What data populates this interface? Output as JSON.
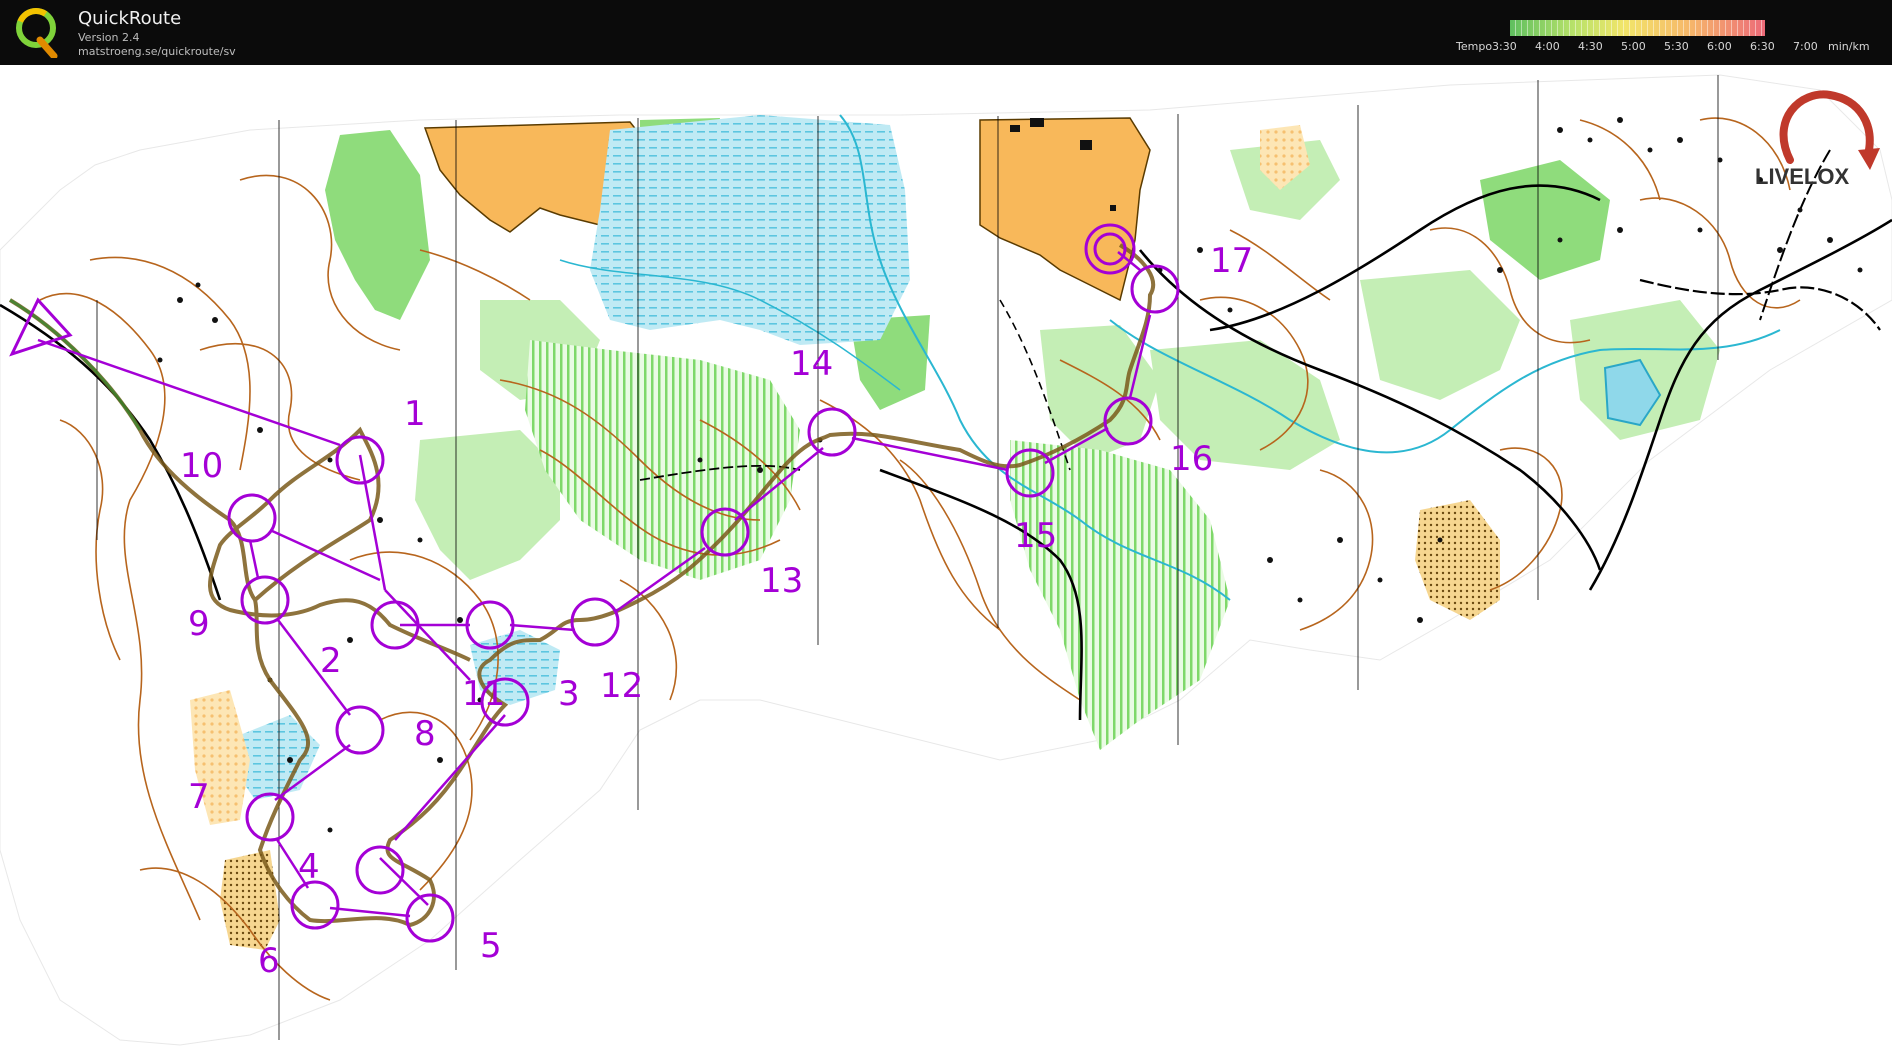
{
  "app": {
    "name": "QuickRoute",
    "version": "Version 2.4",
    "url": "matstroeng.se/quickroute/sv"
  },
  "tempo_scale": {
    "label": "Tempo",
    "ticks": [
      "3:30",
      "4:00",
      "4:30",
      "5:00",
      "5:30",
      "6:00",
      "6:30",
      "7:00"
    ],
    "unit": "min/km",
    "colors": [
      "#5fbf5f",
      "#9fd66a",
      "#d8ea6e",
      "#f5e26a",
      "#f6c06a",
      "#f39a6a",
      "#ee7a6e",
      "#e86a7a"
    ]
  },
  "watermark": {
    "text": "LIVELOX"
  },
  "course": {
    "color": "#a400d6",
    "controls": [
      "1",
      "2",
      "3",
      "4",
      "5",
      "6",
      "7",
      "8",
      "9",
      "10",
      "11",
      "12",
      "13",
      "14",
      "15",
      "16",
      "17"
    ]
  },
  "map_colors": {
    "open_land": "#f8b85a",
    "green": "#8fdc7c",
    "light_green": "#c4eeb5",
    "water": "#8fd8ea",
    "contour": "#b7651d",
    "route": "#7a5b1b",
    "road": "#000000"
  }
}
